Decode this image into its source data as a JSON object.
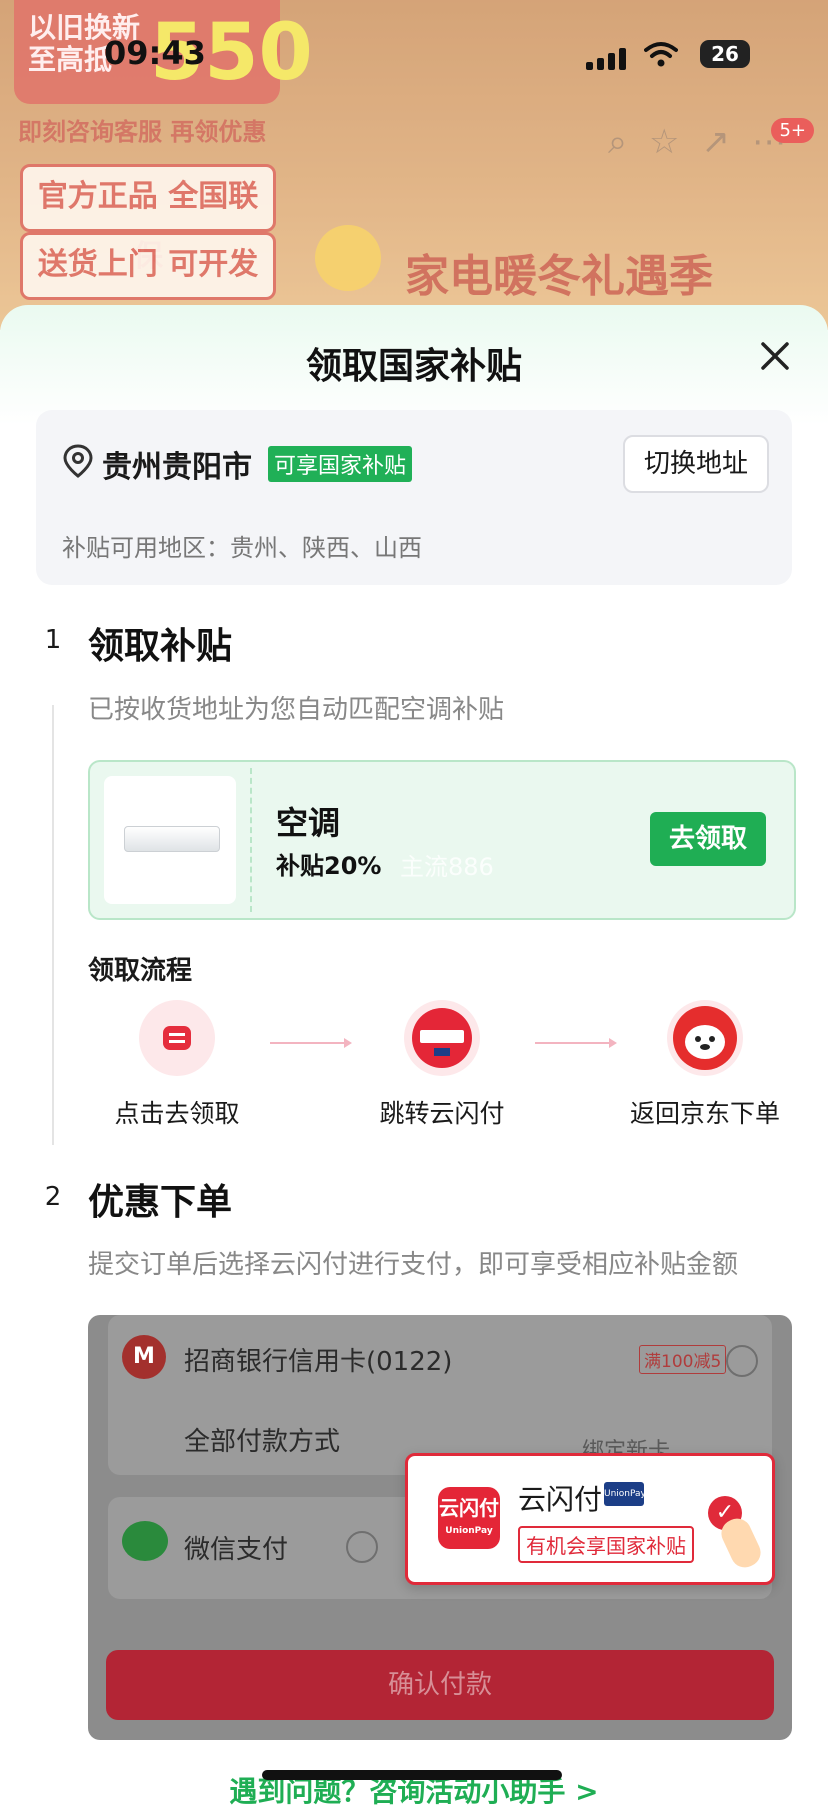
{
  "status_bar": {
    "time": "09:43",
    "battery": "26"
  },
  "background": {
    "promo_line1": "以旧换新",
    "promo_line2": "至高抵",
    "promo_amount": "550",
    "promo_sub": "即刻咨询客服 再领优惠",
    "pill1": "官方正品 全国联保",
    "pill2": "送货上门 可开发票",
    "slogan": "家电暖冬礼遇季",
    "message_badge": "5+"
  },
  "sheet": {
    "title": "领取国家补贴",
    "address": {
      "city": "贵州贵阳市",
      "eligibility_tag": "可享国家补贴",
      "switch_label": "切换地址",
      "region_text": "补贴可用地区：贵州、陕西、山西"
    },
    "step1": {
      "number": "1",
      "title": "领取补贴",
      "desc": "已按收货地址为您自动匹配空调补贴",
      "coupon": {
        "name": "空调",
        "rate": "补贴20%",
        "watermark": "主流886",
        "claim_label": "去领取"
      },
      "flow_title": "领取流程",
      "flow": [
        {
          "label": "点击去领取",
          "icon": "claim-icon"
        },
        {
          "label": "跳转云闪付",
          "icon": "unionpay-quickpass-icon"
        },
        {
          "label": "返回京东下单",
          "icon": "jd-mascot-icon"
        }
      ]
    },
    "step2": {
      "number": "2",
      "title": "优惠下单",
      "desc": "提交订单后选择云闪付进行支付，即可享受相应补贴金额",
      "payment": {
        "bank_card": "招商银行信用卡(0122)",
        "bank_promo": "满100减5",
        "all_methods": "全部付款方式",
        "bind_new": "绑定新卡",
        "wechat": "微信支付",
        "confirm_label": "确认付款"
      },
      "popup": {
        "logo_text": "云闪付",
        "logo_sub": "UnionPay",
        "name": "云闪付",
        "mini_logo": "UnionPay 银联",
        "tag": "有机会享国家补贴"
      }
    },
    "help_link": "遇到问题？咨询活动小助手 >"
  },
  "colors": {
    "accent_green": "#1fae54",
    "unionpay_red": "#e02a3a",
    "confirm_red": "#b32535"
  }
}
